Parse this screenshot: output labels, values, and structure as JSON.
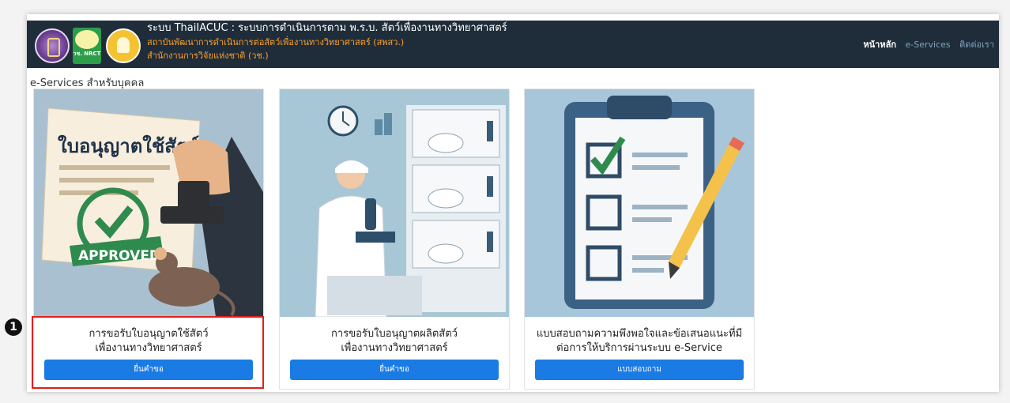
{
  "header": {
    "title": "ระบบ ThaiIACUC : ระบบการดำเนินการตาม พ.ร.บ. สัตว์เพื่องานทางวิทยาศาสตร์",
    "subtitle1": "สถาบันพัฒนาการดำเนินการต่อสัตว์เพื่องานทางวิทยาศาสตร์ (สพสว.)",
    "subtitle2": "สำนักงานการวิจัยแห่งชาติ (วช.)",
    "logo2_text": "วช. NRCT",
    "nav": [
      "หน้าหลัก",
      "e-Services",
      "ติดต่อเรา"
    ]
  },
  "section_title": "e-Services สำหรับบุคคล",
  "cards": [
    {
      "image_text": "ใบอนุญาตใช้สัตว์ฯ",
      "stamp_text": "APPROVED",
      "line1": "การขอรับใบอนุญาตใช้สัตว์",
      "line2": "เพื่องานทางวิทยาศาสตร์",
      "button": "ยื่นคำขอ"
    },
    {
      "line1": "การขอรับใบอนุญาตผลิตสัตว์",
      "line2": "เพื่องานทางวิทยาศาสตร์",
      "button": "ยื่นคำขอ"
    },
    {
      "line1": "แบบสอบถามความพึงพอใจและข้อเสนอแนะที่มี",
      "line2": "ต่อการให้บริการผ่านระบบ e-Service",
      "button": "แบบสอบถาม"
    }
  ],
  "step_marker": "1",
  "colors": {
    "navbar_bg": "#1f2d3a",
    "accent_orange": "#ff9f2a",
    "button_blue": "#1a7be5",
    "highlight_red": "#e0201e"
  }
}
